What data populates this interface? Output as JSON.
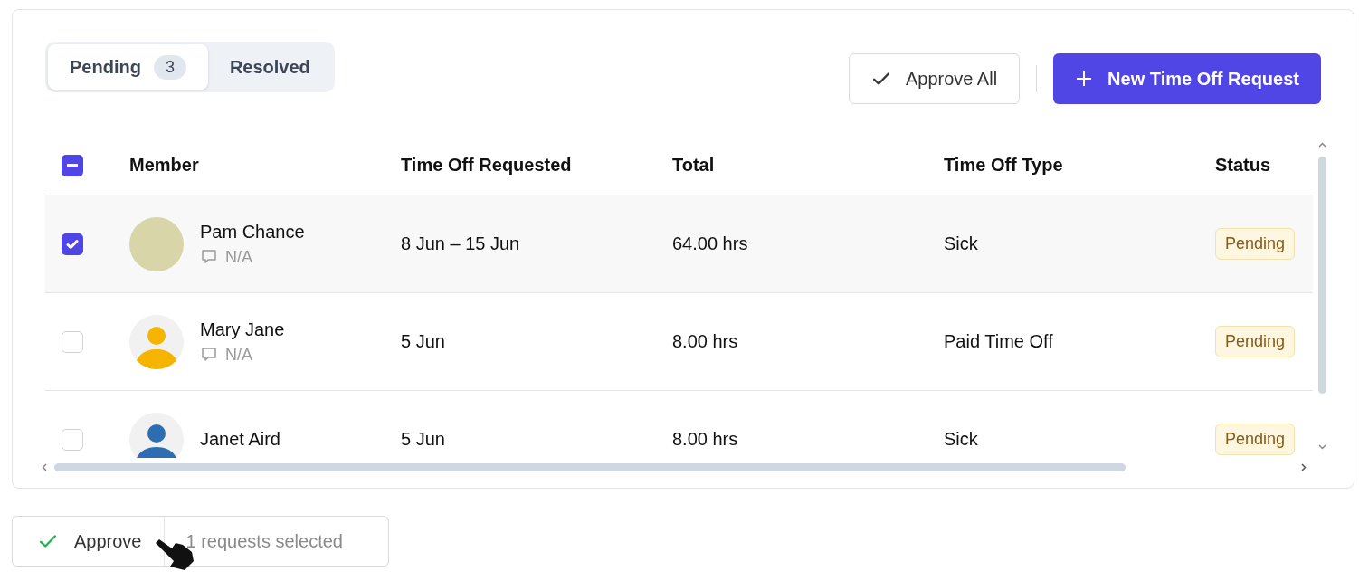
{
  "tabs": [
    {
      "label": "Pending",
      "count": "3",
      "selected": true
    },
    {
      "label": "Resolved",
      "selected": false
    }
  ],
  "actions": {
    "approve_all": "Approve All",
    "new_request": "New Time Off Request"
  },
  "table": {
    "select_all_indeterminate": true,
    "columns": [
      "Member",
      "Time Off Requested",
      "Total",
      "Time Off Type",
      "Status"
    ],
    "rows": [
      {
        "selected": true,
        "avatar": {
          "kind": "photo"
        },
        "name": "Pam Chance",
        "note": "N/A",
        "requested": "8 Jun – 15 Jun",
        "total": "64.00 hrs",
        "type": "Sick",
        "status": "Pending"
      },
      {
        "selected": false,
        "avatar": {
          "kind": "silhouette",
          "color": "#f5b400"
        },
        "name": "Mary Jane",
        "note": "N/A",
        "requested": "5 Jun",
        "total": "8.00 hrs",
        "type": "Paid Time Off",
        "status": "Pending"
      },
      {
        "selected": false,
        "avatar": {
          "kind": "silhouette",
          "color": "#2f6db3"
        },
        "name": "Janet Aird",
        "requested": "5 Jun",
        "total": "8.00 hrs",
        "type": "Sick",
        "status": "Pending"
      }
    ]
  },
  "selection_bar": {
    "approve": "Approve",
    "summary": "1 requests selected"
  }
}
